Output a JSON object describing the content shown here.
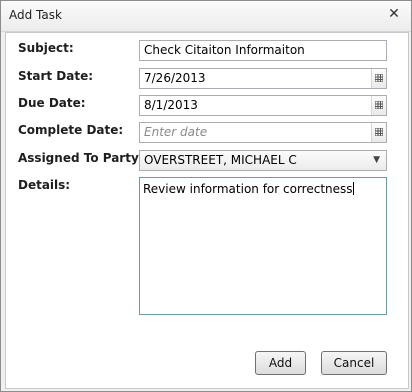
{
  "window": {
    "title": "Add Task",
    "close_glyph": "✕"
  },
  "form": {
    "subject": {
      "label": "Subject:",
      "value": "Check Citaiton Informaiton"
    },
    "start_date": {
      "label": "Start Date:",
      "value": "7/26/2013"
    },
    "due_date": {
      "label": "Due Date:",
      "value": "8/1/2013"
    },
    "complete_date": {
      "label": "Complete Date:",
      "value": "",
      "placeholder": "Enter date"
    },
    "assigned_to": {
      "label": "Assigned To Party:",
      "value": "OVERSTREET, MICHAEL C"
    },
    "details": {
      "label": "Details:",
      "value": "Review information for correctness"
    }
  },
  "buttons": {
    "add": "Add",
    "cancel": "Cancel"
  },
  "icons": {
    "calendar": "calendar-icon",
    "dropdown": "chevron-down-icon",
    "close": "close-icon"
  }
}
